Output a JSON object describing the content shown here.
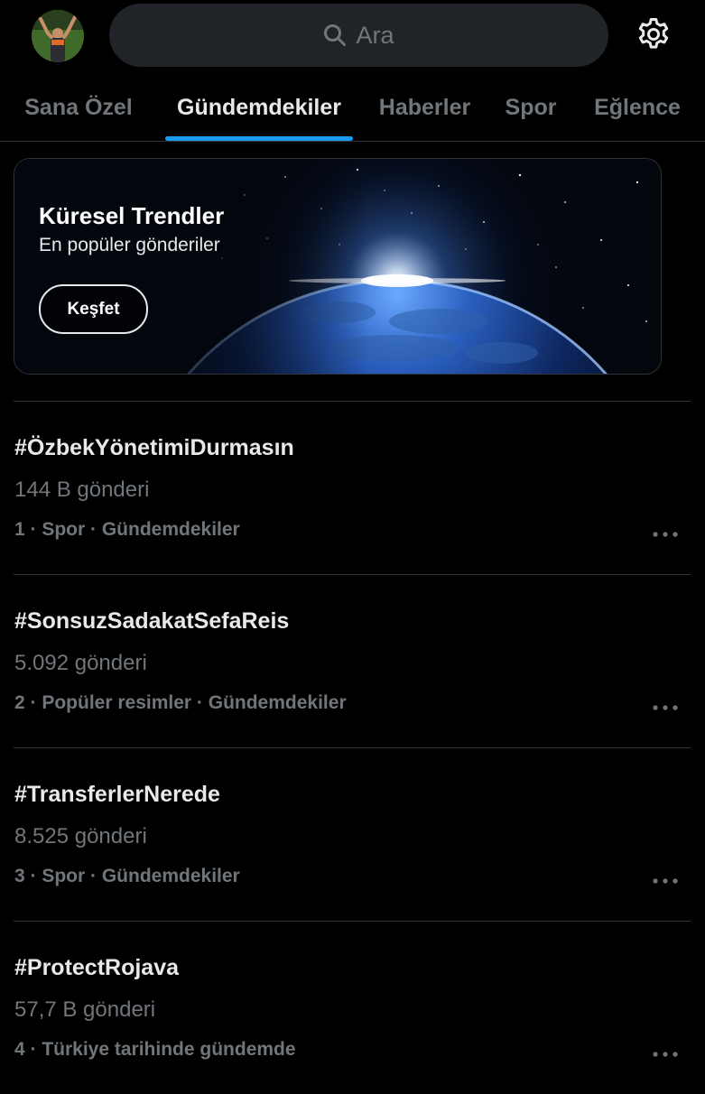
{
  "search": {
    "placeholder": "Ara"
  },
  "tabs": [
    {
      "label": "Sana Özel",
      "active": false
    },
    {
      "label": "Gündemdekiler",
      "active": true
    },
    {
      "label": "Haberler",
      "active": false
    },
    {
      "label": "Spor",
      "active": false
    },
    {
      "label": "Eğlence",
      "active": false
    }
  ],
  "banner": {
    "title": "Küresel Trendler",
    "subtitle": "En popüler gönderiler",
    "button_label": "Keşfet"
  },
  "trends": [
    {
      "name": "#ÖzbekYönetimiDurmasın",
      "count": "144 B gönderi",
      "meta": "1 · Spor · Gündemdekiler"
    },
    {
      "name": "#SonsuzSadakatSefaReis",
      "count": "5.092 gönderi",
      "meta": "2 · Popüler resimler · Gündemdekiler"
    },
    {
      "name": "#TransferlerNerede",
      "count": "8.525 gönderi",
      "meta": "3 · Spor · Gündemdekiler"
    },
    {
      "name": "#ProtectRojava",
      "count": "57,7 B gönderi",
      "meta": "4 · Türkiye tarihinde gündemde"
    }
  ],
  "icons": {
    "search": "search-icon",
    "settings": "gear-icon",
    "more": "more-icon"
  },
  "colors": {
    "background": "#000000",
    "accent": "#1d9bf0",
    "text_primary": "#e7e9ea",
    "text_secondary": "#71767b",
    "search_bg": "#202327",
    "divider": "#2f3336"
  }
}
